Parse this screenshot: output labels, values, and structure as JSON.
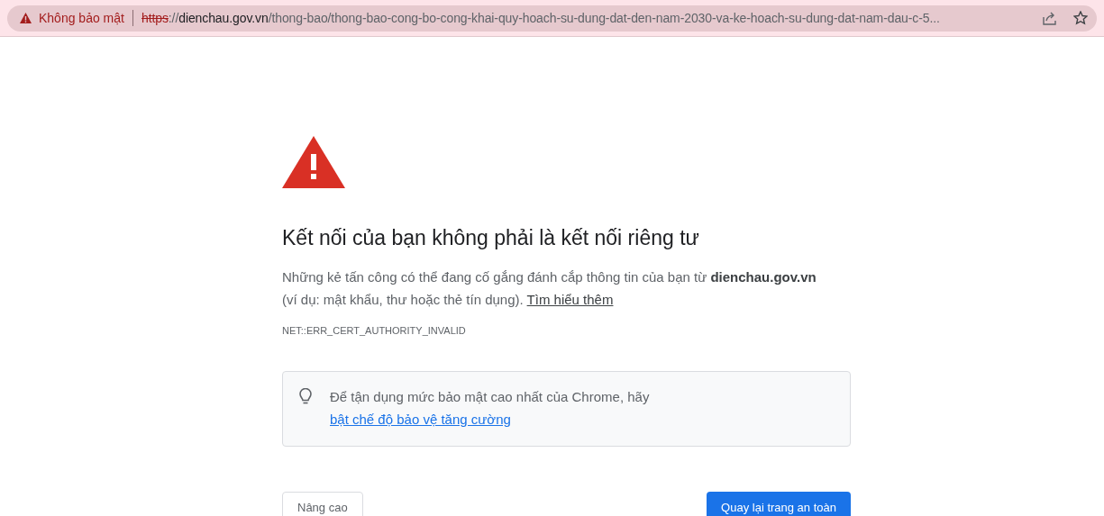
{
  "address_bar": {
    "security_label": "Không bảo mật",
    "url_parts": [
      {
        "kind": "scheme",
        "text": "https"
      },
      {
        "kind": "separator",
        "text": "://"
      },
      {
        "kind": "host",
        "text": "dienchau.gov.vn"
      },
      {
        "kind": "path",
        "text": "/thong-bao/thong-bao-cong-bo-cong-khai-quy-hoach-su-dung-dat-den-nam-2030-va-ke-hoach-su-dung-dat-nam-dau-c-5..."
      }
    ]
  },
  "error": {
    "heading": "Kết nối của bạn không phải là kết nối riêng tư",
    "message": "Những kẻ tấn công có thể đang cố gắng đánh cắp thông tin của bạn từ **dienchau.gov.vn** (ví dụ: mật khẩu, thư hoặc thẻ tín dụng).",
    "learn_more_link": "Tìm hiểu thêm",
    "code": "NET::ERR_CERT_AUTHORITY_INVALID"
  },
  "tip": {
    "text": "Để tận dụng mức bảo mật cao nhất của Chrome, hãy",
    "link": "bật chế độ bảo vệ tăng cường"
  },
  "buttons": {
    "advanced": "Nâng cao",
    "back_to_safety": "Quay lại trang an toàn"
  }
}
